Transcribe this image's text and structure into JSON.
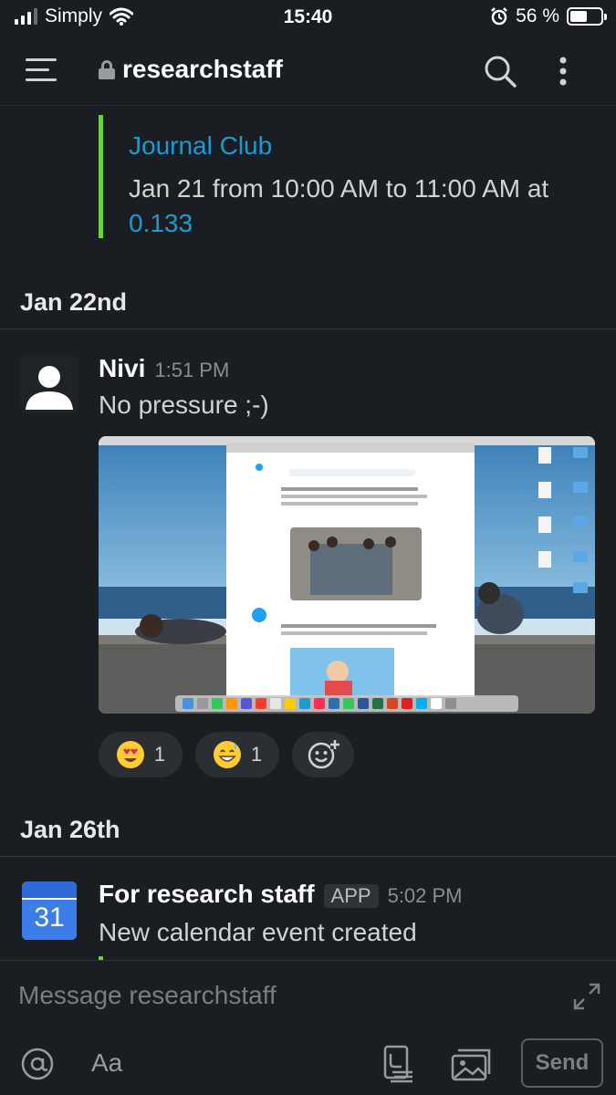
{
  "status_bar": {
    "carrier": "Simply",
    "time": "15:40",
    "battery_percent": "56 %",
    "battery_level": 0.56
  },
  "header": {
    "channel_name": "researchstaff",
    "icons": [
      "hamburger-menu-icon",
      "lock-icon",
      "search-icon",
      "more-vertical-icon"
    ]
  },
  "event": {
    "title": "Journal Club",
    "description_prefix": "Jan 21 from 10:00 AM to 11:00 AM at ",
    "location_link": "0.133",
    "accent": "#6cd13d"
  },
  "dividers": [
    {
      "label": "Jan 22nd"
    },
    {
      "label": "Jan 26th"
    }
  ],
  "messages": [
    {
      "author": "Nivi",
      "time": "1:51 PM",
      "text": "No pressure ;-)",
      "reactions": [
        {
          "emoji": "heart-eyes-emoji",
          "count": "1"
        },
        {
          "emoji": "grinning-sweat-emoji",
          "count": "1"
        }
      ]
    },
    {
      "author": "For research staff",
      "badge": "APP",
      "time": "5:02 PM",
      "text": "New calendar event created",
      "calendar_day": "31"
    }
  ],
  "composer": {
    "placeholder": "Message researchstaff",
    "format_label": "Aa",
    "send_label": "Send"
  },
  "colors": {
    "background": "#1a1d21",
    "link": "#1d9bd1",
    "event_bar": "#6cd13d"
  }
}
